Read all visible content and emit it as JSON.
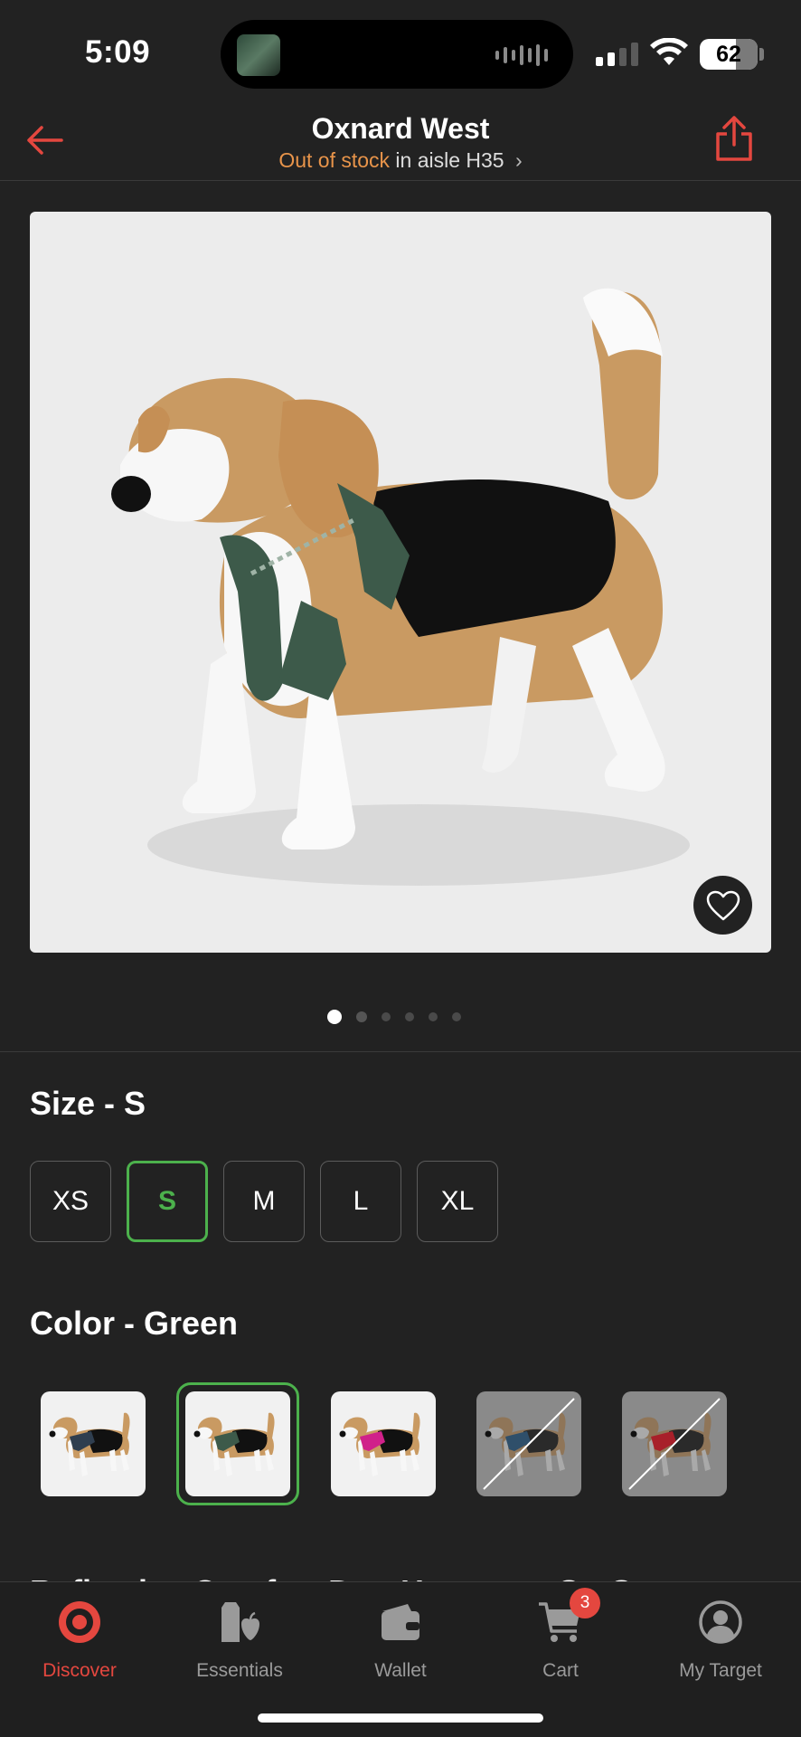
{
  "status_bar": {
    "time": "5:09",
    "battery": "62"
  },
  "header": {
    "title": "Oxnard West",
    "stock_status": "Out of stock",
    "aisle_text": "in aisle H35",
    "status_color": "#e8944a",
    "back_icon": "back-arrow-icon",
    "share_icon": "share-icon"
  },
  "product": {
    "image_count": 6,
    "current_image": 1,
    "favorite_icon": "heart-icon"
  },
  "size": {
    "heading": "Size - S",
    "options": [
      "XS",
      "S",
      "M",
      "L",
      "XL"
    ],
    "selected": "S"
  },
  "color": {
    "heading": "Color - Green",
    "swatches": [
      {
        "color": "#2f3e4f",
        "available": true,
        "selected": false
      },
      {
        "color": "#3d5a4a",
        "available": true,
        "selected": true
      },
      {
        "color": "#d0218a",
        "available": true,
        "selected": false
      },
      {
        "color": "#2f4f6a",
        "available": false,
        "selected": false
      },
      {
        "color": "#a8202a",
        "available": false,
        "selected": false
      }
    ]
  },
  "product_title_peek": "Reflective Comfort Dog Harness - S - Green",
  "tab_bar": {
    "tabs": [
      {
        "label": "Discover",
        "icon": "target-logo-icon",
        "active": true
      },
      {
        "label": "Essentials",
        "icon": "essentials-icon",
        "active": false
      },
      {
        "label": "Wallet",
        "icon": "wallet-icon",
        "active": false
      },
      {
        "label": "Cart",
        "icon": "cart-icon",
        "active": false,
        "badge": "3"
      },
      {
        "label": "My Target",
        "icon": "profile-icon",
        "active": false
      }
    ]
  },
  "colors": {
    "accent": "#e4473f",
    "selected_green": "#4cb14c",
    "background": "#222222"
  }
}
